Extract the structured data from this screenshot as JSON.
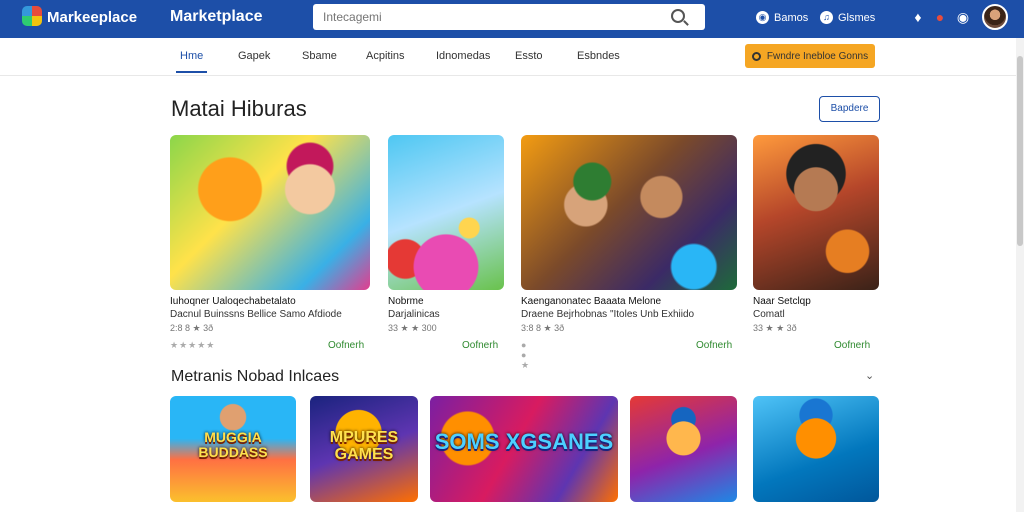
{
  "header": {
    "brand_small": "Markeeplace",
    "brand_large": "Marketplace",
    "search_placeholder": "Intecagemi",
    "link_1": "Bamos",
    "link_2": "Glsmes"
  },
  "nav": {
    "items": [
      "Hme",
      "Gapek",
      "Sbame",
      "Acpitins",
      "Idnomedas",
      "Essto",
      "Esbndes"
    ],
    "active_index": 0,
    "promo_label": "Fwndre Inebloe Gonns"
  },
  "section_1": {
    "title": "Matai Hiburas",
    "action_label": "Bapdere",
    "cards": [
      {
        "title": "Iuhoqner Ualoqechabetalato",
        "subtitle": "Dacnul Buinssns Bellice Samo Afdiode",
        "meta": "2:8 8 ★ 3ð",
        "action": "Oofnerh"
      },
      {
        "title": "Nobrme",
        "subtitle": "Darjalinicas",
        "meta": "33 ★ ★ 300",
        "action": "Oofnerh"
      },
      {
        "title": "Kaenganonatec Baaata Melone",
        "subtitle": "Draene Bejrhobnas \"Itoles Unb Exhiido",
        "meta": "3:8 8 ★ 3ð",
        "action": "Oofnerh"
      },
      {
        "title": "Naar Setclqp",
        "subtitle": "Comatl",
        "meta": "33 ★ ★ 3ð",
        "action": "Oofnerh"
      }
    ]
  },
  "section_2": {
    "title": "Metranis Nobad Inlcaes",
    "cards": [
      {
        "art_text": "MUGGIA BUDDASS"
      },
      {
        "art_text": "MPURES GAMES"
      },
      {
        "art_text": "SOMS XGSANES"
      },
      {
        "art_text": ""
      },
      {
        "art_text": ""
      }
    ]
  },
  "colors": {
    "topbar": "#1d4fa8",
    "accent": "#1d4fa8",
    "promo": "#f5a623",
    "action_green": "#2f8a2f"
  },
  "icons": [
    "app-logo-icon",
    "search-icon",
    "notification-icon",
    "gift-icon",
    "settings-icon",
    "chevron-down-icon",
    "star-icon"
  ]
}
